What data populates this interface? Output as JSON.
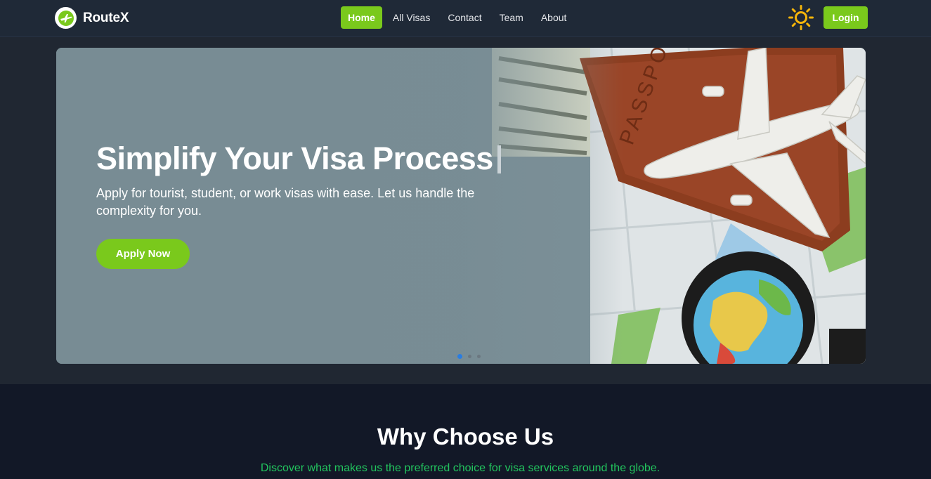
{
  "brand": {
    "name": "RouteX",
    "logo_icon": "plane-logo-icon"
  },
  "nav": {
    "links": [
      {
        "label": "Home",
        "active": true
      },
      {
        "label": "All Visas",
        "active": false
      },
      {
        "label": "Contact",
        "active": false
      },
      {
        "label": "Team",
        "active": false
      },
      {
        "label": "About",
        "active": false
      }
    ],
    "theme_icon": "sun-icon",
    "login_label": "Login"
  },
  "hero": {
    "title": "Simplify Your Visa Process",
    "subtitle": "Apply for tourist, student, or work visas with ease. Let us handle the complexity for you.",
    "cta_label": "Apply Now",
    "slides": 3,
    "active_slide": 1
  },
  "why": {
    "title": "Why Choose Us",
    "subtitle": "Discover what makes us the preferred choice for visa services around the globe."
  },
  "colors": {
    "accent": "#7ac91c",
    "nav_bg": "#1f2937",
    "page_bg": "#121827",
    "subtitle_green": "#22c55e",
    "active_dot": "#2a7de1"
  }
}
